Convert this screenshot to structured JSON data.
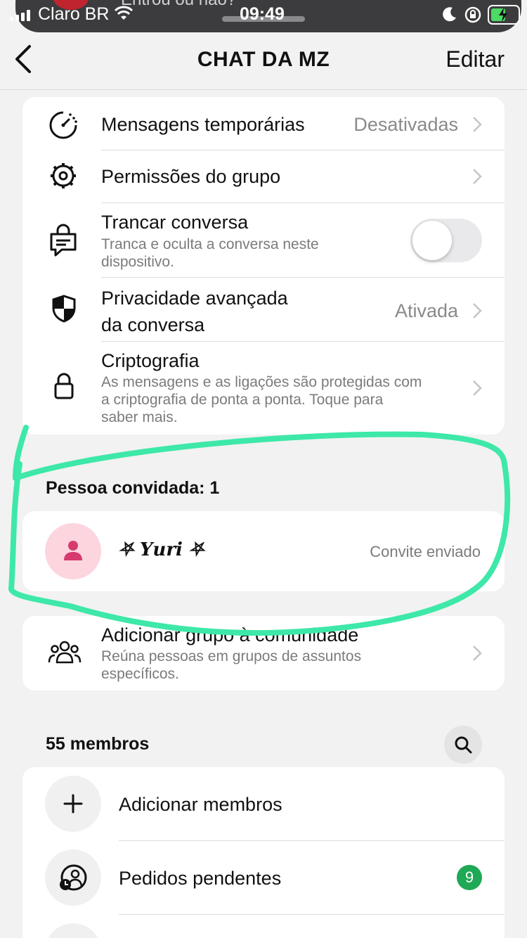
{
  "status_bar": {
    "carrier": "Claro BR",
    "time": "09:49",
    "notification_preview": "Entrou ou não?"
  },
  "nav": {
    "title": "CHAT DA MZ",
    "edit_label": "Editar"
  },
  "settings": {
    "temporary_messages": {
      "label": "Mensagens temporárias",
      "value": "Desativadas"
    },
    "group_permissions": {
      "label": "Permissões do grupo"
    },
    "lock_chat": {
      "label": "Trancar conversa",
      "subtitle_line1": "Tranca e oculta a conversa neste",
      "subtitle_line2": "dispositivo.",
      "enabled": false
    },
    "advanced_privacy": {
      "label_line1": "Privacidade avançada",
      "label_line2": "da conversa",
      "value": "Ativada"
    },
    "encryption": {
      "label": "Criptografia",
      "subtitle_line1": "As mensagens e as ligações são protegidas com",
      "subtitle_line2": "a criptografia de ponta a ponta. Toque para",
      "subtitle_line3": "saber mais."
    }
  },
  "invited": {
    "header": "Pessoa convidada: 1",
    "person": {
      "name": "⛧ 𝒀𝒖𝒓𝒊 ⛧",
      "status": "Convite enviado"
    }
  },
  "community": {
    "label": "Adicionar grupo à comunidade",
    "subtitle_line1": "Reúna pessoas em grupos de assuntos",
    "subtitle_line2": "específicos."
  },
  "members": {
    "header": "55 membros",
    "add_label": "Adicionar membros",
    "pending_label": "Pedidos pendentes",
    "pending_count": "9"
  },
  "colors": {
    "highlight": "#3de8a8",
    "badge": "#1fa855",
    "invitee_avatar_bg": "#fcd5df",
    "invitee_avatar_fg": "#d63a6e"
  }
}
